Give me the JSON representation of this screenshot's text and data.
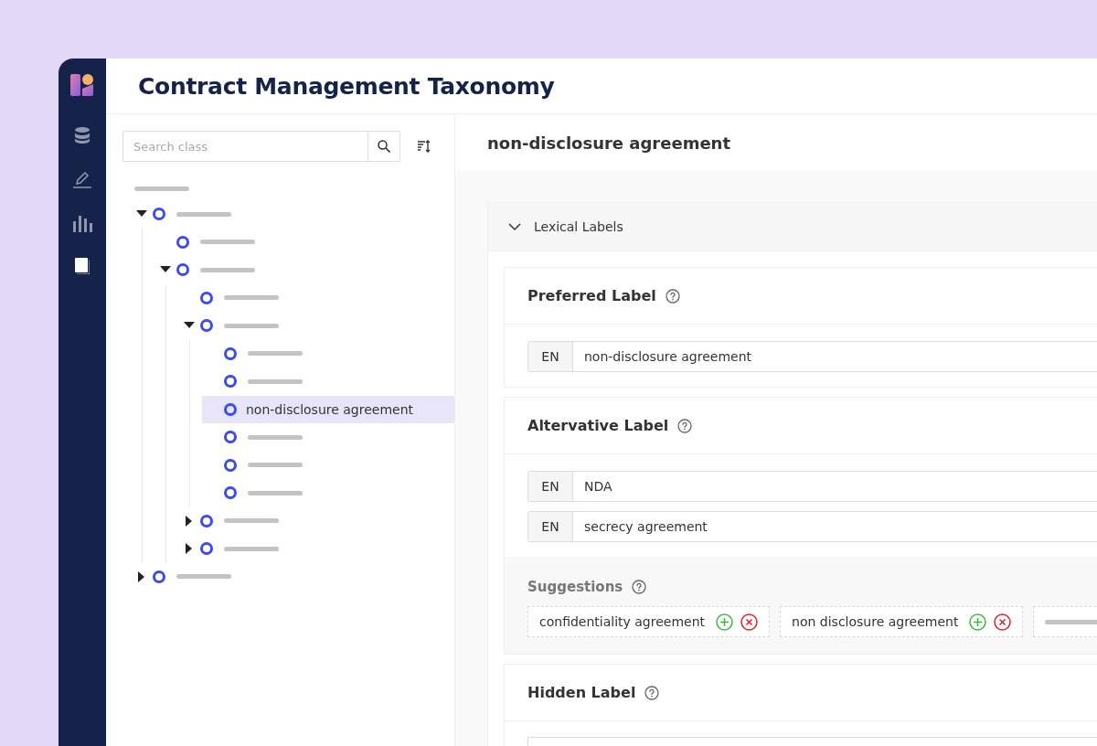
{
  "title": "Contract Management Taxonomy",
  "search": {
    "placeholder": "Search class"
  },
  "tree": [
    {
      "kind": "placeholder",
      "selected": false,
      "expanded": true,
      "children": [
        {
          "kind": "placeholder",
          "selected": false
        },
        {
          "kind": "placeholder",
          "selected": false,
          "expanded": true,
          "children": [
            {
              "kind": "placeholder",
              "selected": false
            },
            {
              "kind": "placeholder",
              "selected": false,
              "expanded": true,
              "children": [
                {
                  "kind": "placeholder",
                  "selected": false
                },
                {
                  "kind": "placeholder",
                  "selected": false
                },
                {
                  "kind": "label",
                  "label": "non-disclosure agreement",
                  "selected": true
                },
                {
                  "kind": "placeholder",
                  "selected": false
                },
                {
                  "kind": "placeholder",
                  "selected": false
                },
                {
                  "kind": "placeholder",
                  "selected": false
                }
              ]
            },
            {
              "kind": "placeholder",
              "selected": false,
              "expanded": false
            },
            {
              "kind": "placeholder",
              "selected": false,
              "expanded": false
            }
          ]
        }
      ]
    },
    {
      "kind": "placeholder",
      "selected": false,
      "expanded": false
    }
  ],
  "detail": {
    "title": "non-disclosure agreement",
    "panel": {
      "title": "Lexical Labels",
      "expanded": true
    },
    "sections": [
      {
        "title": "Preferred Label",
        "values": [
          {
            "lang": "EN",
            "value": "non-disclosure agreement"
          }
        ]
      },
      {
        "title": "Altervative Label",
        "values": [
          {
            "lang": "EN",
            "value": "NDA"
          },
          {
            "lang": "EN",
            "value": "secrecy agreement"
          }
        ],
        "suggestions": {
          "title": "Suggestions",
          "items": [
            {
              "kind": "text",
              "text": "confidentiality agreement"
            },
            {
              "kind": "text",
              "text": "non disclosure agreement"
            },
            {
              "kind": "placeholder"
            }
          ]
        }
      },
      {
        "title": "Hidden Label"
      }
    ]
  }
}
